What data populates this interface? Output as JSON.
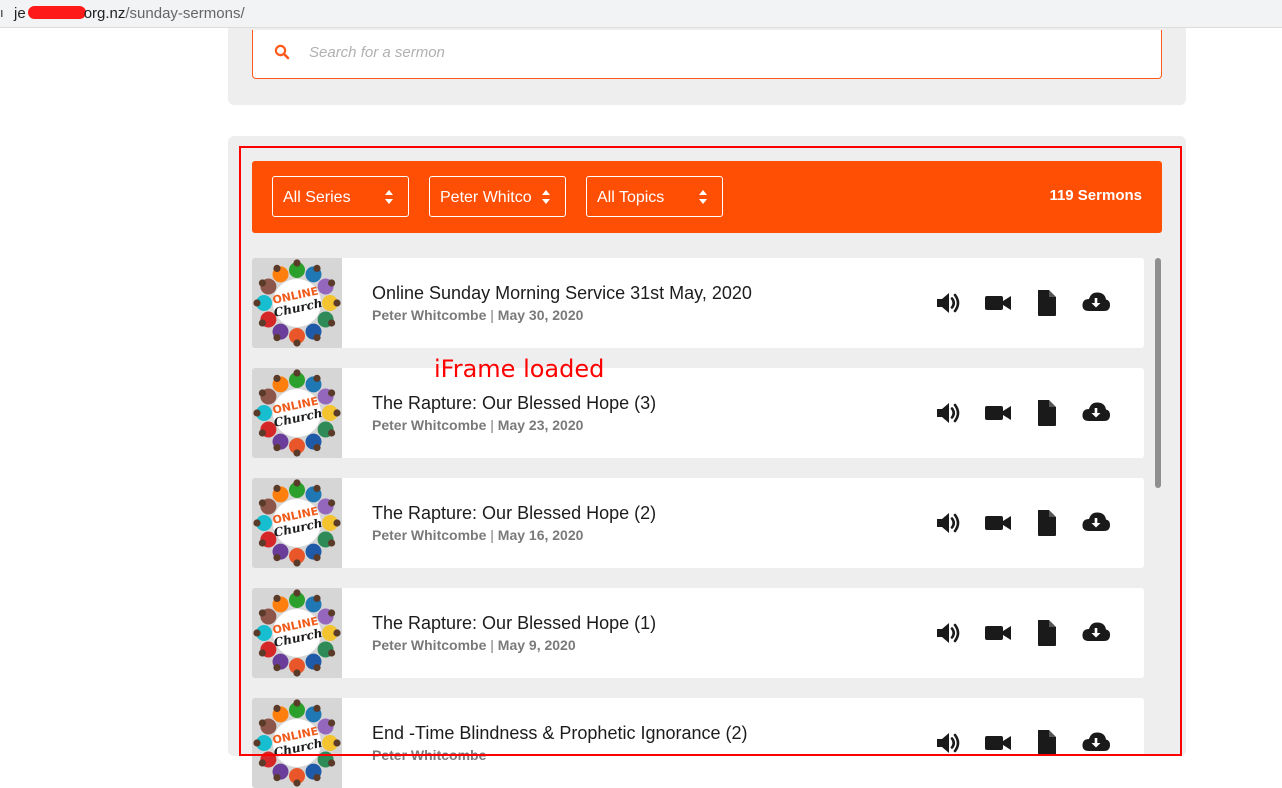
{
  "browser": {
    "url_prefix": "je",
    "url_domain_tail": "org.nz",
    "url_path": "/sunday-sermons/"
  },
  "search": {
    "placeholder": "Search for a sermon",
    "icon": "search-icon"
  },
  "filters": {
    "series_label": "All Series",
    "speaker_label": "Peter Whitcombe",
    "topics_label": "All Topics",
    "count_label": "119 Sermons"
  },
  "annotation": {
    "iframe_note": "iFrame loaded"
  },
  "sermons": [
    {
      "title": "Online Sunday Morning Service 31st May, 2020",
      "speaker": "Peter Whitcombe",
      "date": "May 30, 2020"
    },
    {
      "title": "The Rapture: Our Blessed Hope (3)",
      "speaker": "Peter Whitcombe",
      "date": "May 23, 2020"
    },
    {
      "title": "The Rapture: Our Blessed Hope (2)",
      "speaker": "Peter Whitcombe",
      "date": "May 16, 2020"
    },
    {
      "title": "The Rapture: Our Blessed Hope (1)",
      "speaker": "Peter Whitcombe",
      "date": "May 9, 2020"
    },
    {
      "title": "End -Time Blindness & Prophetic Ignorance (2)",
      "speaker": "Peter Whitcombe",
      "date": ""
    }
  ],
  "thumbnail": {
    "line1": "ONLINE",
    "line2": "Church"
  },
  "icons": [
    "audio-icon",
    "video-icon",
    "document-icon",
    "download-icon"
  ],
  "colors": {
    "accent": "#ff4f05",
    "iframe_outline": "#ff0000"
  }
}
